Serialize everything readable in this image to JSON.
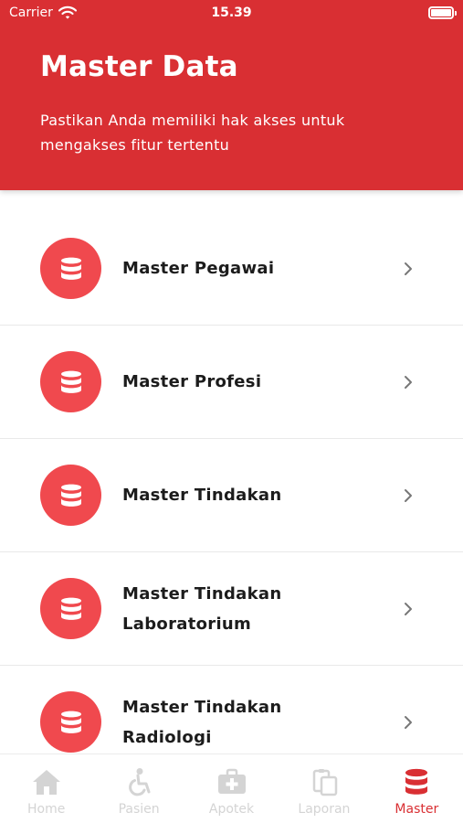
{
  "status_bar": {
    "carrier": "Carrier",
    "time": "15.39"
  },
  "header": {
    "title": "Master Data",
    "subtitle": "Pastikan Anda memiliki hak akses untuk mengakses fitur tertentu"
  },
  "menu": {
    "items": [
      {
        "label": "Master Pegawai",
        "icon": "database-icon"
      },
      {
        "label": "Master Profesi",
        "icon": "database-icon"
      },
      {
        "label": "Master Tindakan",
        "icon": "database-icon"
      },
      {
        "label": "Master Tindakan Laboratorium",
        "icon": "database-icon"
      },
      {
        "label": "Master Tindakan Radiologi",
        "icon": "database-icon"
      }
    ]
  },
  "tabbar": {
    "tabs": [
      {
        "label": "Home",
        "icon": "home-icon",
        "active": false
      },
      {
        "label": "Pasien",
        "icon": "accessibility-icon",
        "active": false
      },
      {
        "label": "Apotek",
        "icon": "medkit-icon",
        "active": false
      },
      {
        "label": "Laporan",
        "icon": "clipboard-copy-icon",
        "active": false
      },
      {
        "label": "Master",
        "icon": "database-icon",
        "active": true
      }
    ]
  },
  "colors": {
    "header_background": "#d92f33",
    "icon_circle": "#f0494e",
    "active_tab": "#d92f33",
    "inactive_tab": "#d4d4d4"
  }
}
